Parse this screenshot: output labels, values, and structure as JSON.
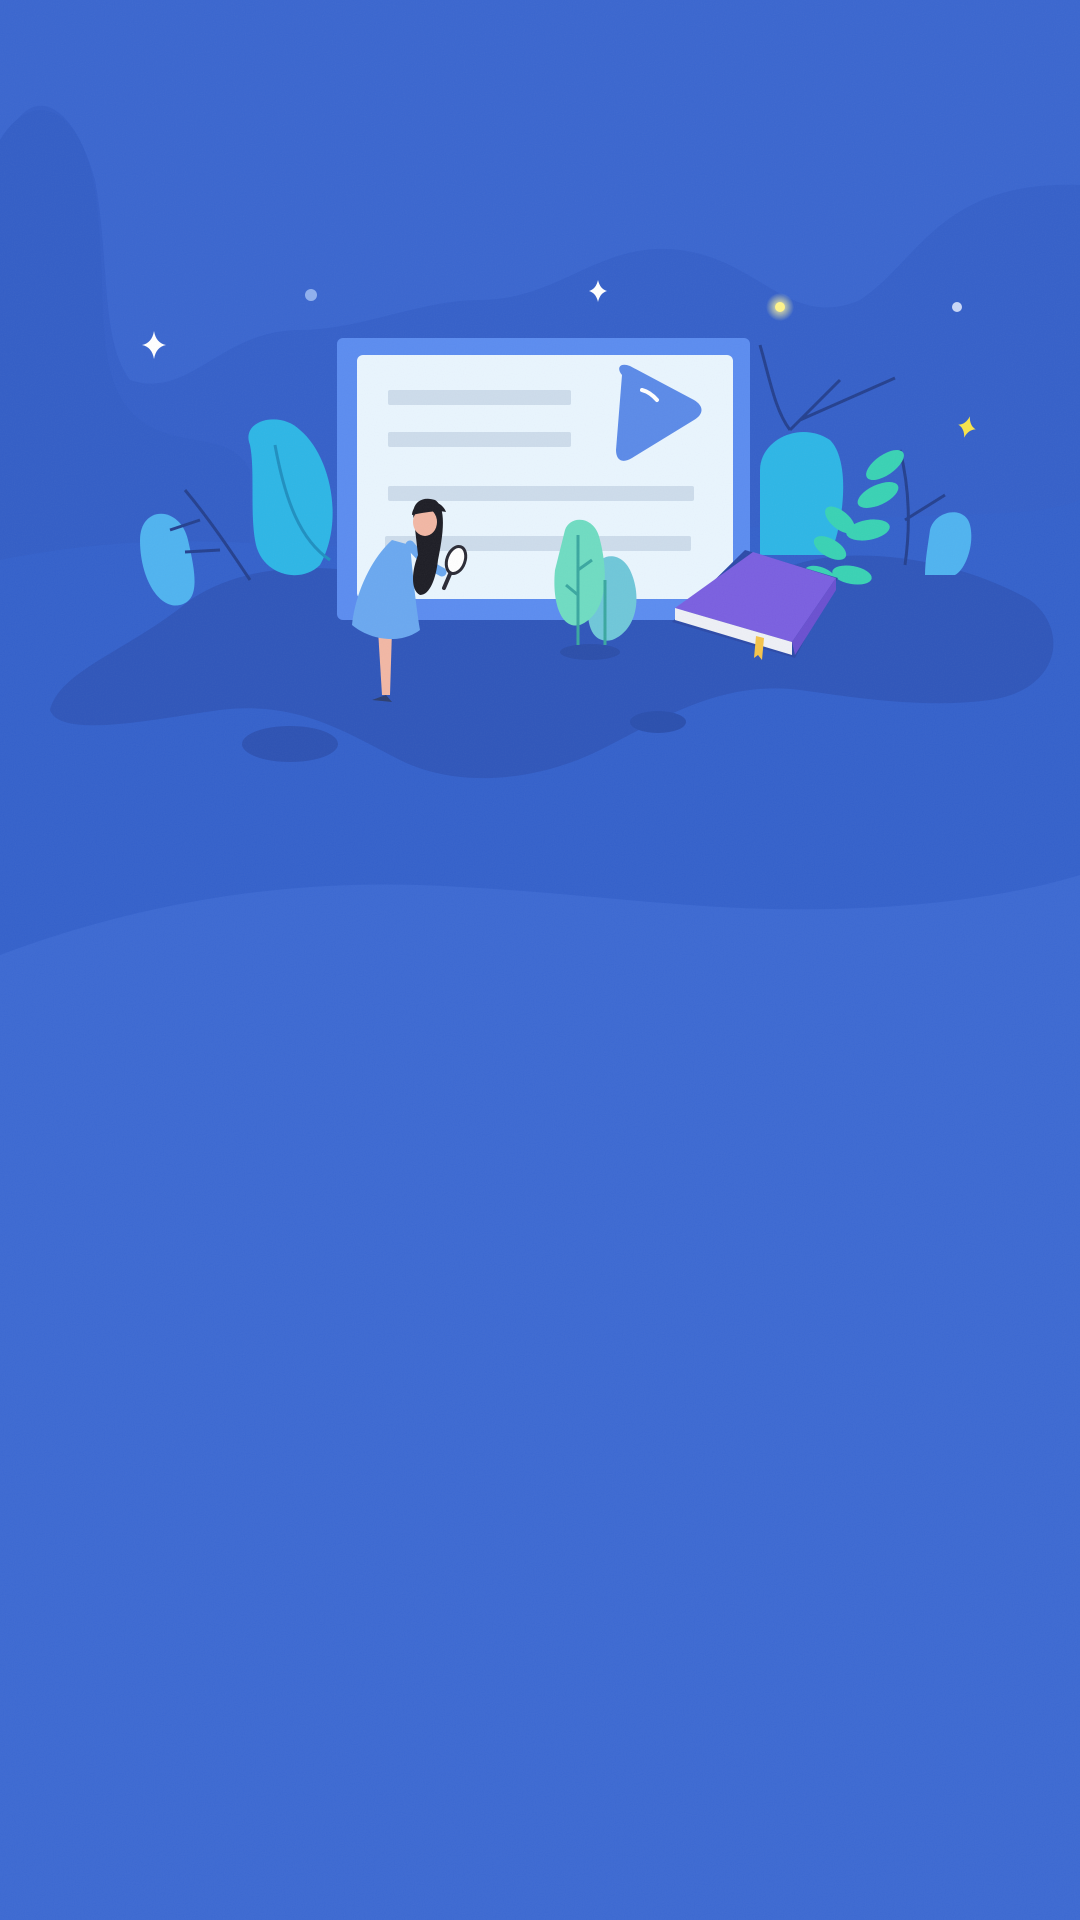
{
  "scene": {
    "description_icons": [
      "sparkle-icon",
      "star-icon",
      "play-icon",
      "magnifier-icon",
      "book-icon"
    ],
    "colors": {
      "background": "#3a66cf",
      "background_top": "#3b66d0",
      "hill_back": "#3460c8",
      "hill_mid": "#325dc3",
      "ground_shadow": "#2d52b3",
      "ground_floor": "#3b68d2",
      "card_frame": "#5b8cf0",
      "card_face": "#e9f5fe",
      "card_line": "#cddceb",
      "play_button": "#5b8ae8",
      "book_cover": "#7a5fe0",
      "book_pages": "#eef0f6",
      "bookmark": "#f5c34a",
      "sparkle_yellow": "#f7e34a",
      "plant_cyan": "#2db6e6",
      "plant_teal": "#39d2b4",
      "plant_mint": "#6fdcc2",
      "dress": "#6aa8f0",
      "hair": "#1d1d25",
      "skin": "#f2b7a4"
    }
  }
}
